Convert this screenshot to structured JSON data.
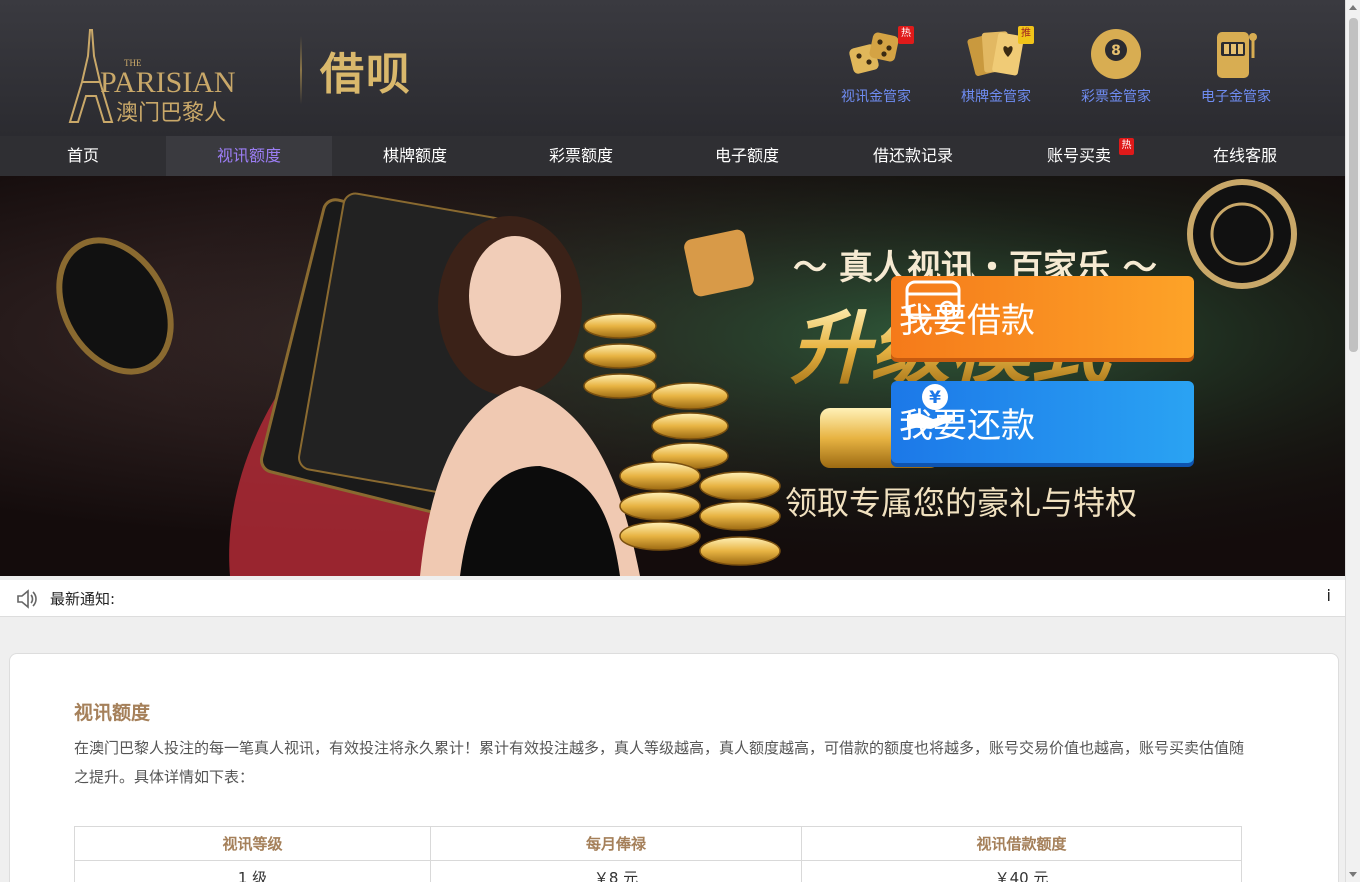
{
  "header": {
    "logo_alt": "THE PARISIAN 澳门巴黎人",
    "title": "借呗",
    "managers": [
      {
        "label": "视讯金管家",
        "badge": "热"
      },
      {
        "label": "棋牌金管家",
        "badge": "推"
      },
      {
        "label": "彩票金管家",
        "badge": ""
      },
      {
        "label": "电子金管家",
        "badge": ""
      }
    ]
  },
  "nav": {
    "items": [
      {
        "label": "首页"
      },
      {
        "label": "视讯额度"
      },
      {
        "label": "棋牌额度"
      },
      {
        "label": "彩票额度"
      },
      {
        "label": "电子额度"
      },
      {
        "label": "借还款记录"
      },
      {
        "label": "账号买卖",
        "badge": "热"
      },
      {
        "label": "在线客服"
      }
    ],
    "active_index": 1
  },
  "banner": {
    "headline": "～ 真人视讯・百家乐 ～",
    "big_text": "升级模式",
    "tagline": "领取专属您的豪礼与特权",
    "borrow_label": "我要借款",
    "repay_label": "我要还款"
  },
  "notice": {
    "label": "最新通知:",
    "edge_char": "i"
  },
  "content": {
    "title": "视讯额度",
    "intro": "在澳门巴黎人投注的每一笔真人视讯，有效投注将永久累计！累计有效投注越多，真人等级越高，真人额度越高，可借款的额度也将越多，账号交易价值也越高，账号买卖估值随之提升。具体详情如下表：",
    "table": {
      "headers": [
        "视讯等级",
        "每月俸禄",
        "视讯借款额度"
      ],
      "rows": [
        [
          "1 级",
          "￥8 元",
          "￥40 元"
        ]
      ]
    }
  },
  "colors": {
    "accent_gold": "#a5805a",
    "nav_active": "#9b7df3",
    "borrow": "#f57a1a",
    "repay": "#1c78e8"
  }
}
